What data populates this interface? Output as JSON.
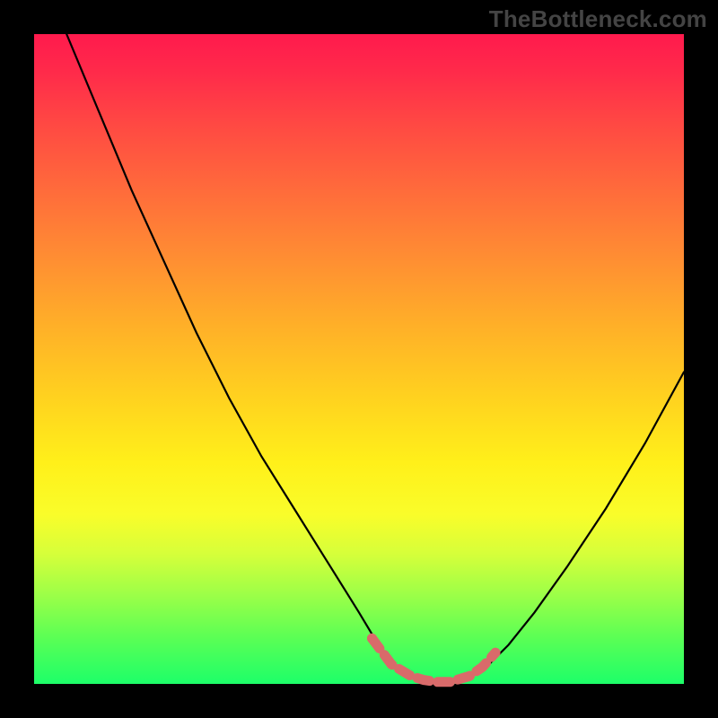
{
  "watermark": "TheBottleneck.com",
  "colors": {
    "background": "#000000",
    "curve_stroke": "#000000",
    "optimal_marker": "#d96a6a",
    "gradient_top": "#ff1a4d",
    "gradient_bottom": "#1dff69"
  },
  "chart_data": {
    "type": "line",
    "title": "",
    "xlabel": "",
    "ylabel": "",
    "xlim": [
      0,
      100
    ],
    "ylim": [
      0,
      100
    ],
    "series": [
      {
        "name": "bottleneck-curve",
        "x": [
          5,
          10,
          15,
          20,
          25,
          30,
          35,
          40,
          45,
          50,
          53,
          55,
          58,
          61,
          64,
          67,
          70,
          73,
          77,
          82,
          88,
          94,
          100
        ],
        "values": [
          100,
          88,
          76,
          65,
          54,
          44,
          35,
          27,
          19,
          11,
          6,
          3,
          1,
          0.2,
          0.2,
          1,
          3,
          6,
          11,
          18,
          27,
          37,
          48
        ]
      },
      {
        "name": "optimal-zone",
        "x": [
          52,
          55,
          58,
          60,
          62,
          64,
          67,
          69,
          71
        ],
        "values": [
          7,
          3,
          1.2,
          0.6,
          0.3,
          0.3,
          1.2,
          2.6,
          4.8
        ]
      }
    ],
    "annotations": []
  }
}
